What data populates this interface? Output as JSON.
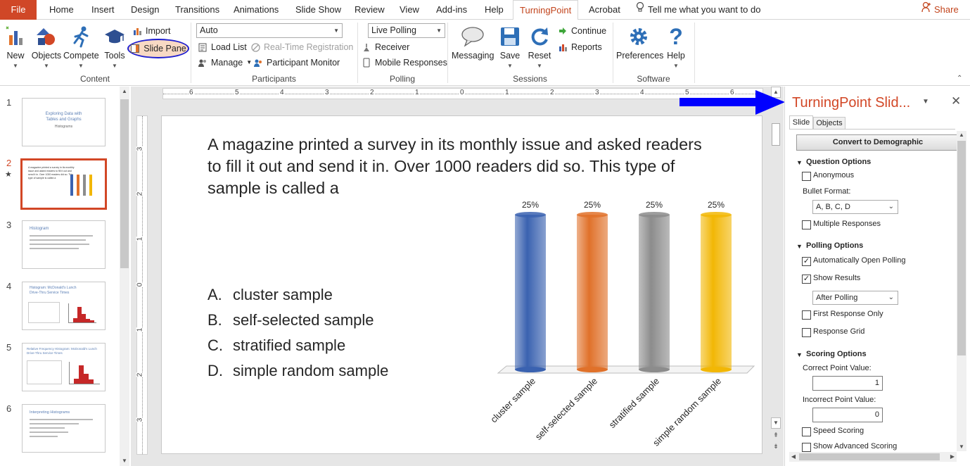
{
  "tabs": {
    "file": "File",
    "home": "Home",
    "insert": "Insert",
    "design": "Design",
    "transitions": "Transitions",
    "animations": "Animations",
    "slideshow": "Slide Show",
    "review": "Review",
    "view": "View",
    "addins": "Add-ins",
    "help": "Help",
    "turningpoint": "TurningPoint",
    "acrobat": "Acrobat",
    "tellme": "Tell me what you want to do",
    "share": "Share"
  },
  "ribbon": {
    "content": {
      "new": "New",
      "objects": "Objects",
      "compete": "Compete",
      "tools": "Tools",
      "import": "Import",
      "slide_pane": "Slide Pane",
      "label": "Content"
    },
    "participants": {
      "combo": "Auto",
      "load_list": "Load List",
      "realtime": "Real-Time Registration",
      "manage": "Manage",
      "monitor": "Participant Monitor",
      "label": "Participants"
    },
    "polling": {
      "combo": "Live Polling",
      "receiver": "Receiver",
      "mobile": "Mobile Responses",
      "label": "Polling"
    },
    "sessions": {
      "messaging": "Messaging",
      "save": "Save",
      "reset": "Reset",
      "continue": "Continue",
      "reports": "Reports",
      "label": "Sessions"
    },
    "software": {
      "preferences": "Preferences",
      "help": "Help",
      "label": "Software"
    }
  },
  "thumbnails": [
    {
      "num": "1",
      "title": "Exploring Data with Tables and Graphs",
      "sub": "Histograms"
    },
    {
      "num": "2",
      "title": "A magazine printed a survey in its monthly issue and asked readers to fill it out and send it in. Over 1000 readers did so. This type of sample is called a",
      "sub": ""
    },
    {
      "num": "3",
      "title": "Histogram",
      "sub": ""
    },
    {
      "num": "4",
      "title": "Histogram: McDonald's Lunch Drive-Thru Service Times",
      "sub": ""
    },
    {
      "num": "5",
      "title": "Relative Frequency Histogram: McDonald's Lunch Drive-Thru Service Times",
      "sub": ""
    },
    {
      "num": "6",
      "title": "Interpreting Histograms",
      "sub": ""
    }
  ],
  "ruler": {
    "h": [
      "6",
      "5",
      "4",
      "3",
      "2",
      "1",
      "0",
      "1",
      "2",
      "3",
      "4",
      "5",
      "6"
    ],
    "v": [
      "3",
      "2",
      "1",
      "0",
      "1",
      "2",
      "3"
    ]
  },
  "slide": {
    "question": "A magazine printed a survey in its monthly issue and asked readers to fill it out and send it in. Over 1000 readers did so. This type of sample is called a",
    "answers": [
      {
        "letter": "A.",
        "text": "cluster sample"
      },
      {
        "letter": "B.",
        "text": "self-selected sample"
      },
      {
        "letter": "C.",
        "text": "stratified sample"
      },
      {
        "letter": "D.",
        "text": "simple random sample"
      }
    ]
  },
  "chart_data": {
    "type": "bar",
    "categories": [
      "cluster sample",
      "self-selected sample",
      "stratified sample",
      "simple random sample"
    ],
    "values": [
      25,
      25,
      25,
      25
    ],
    "data_labels": [
      "25%",
      "25%",
      "25%",
      "25%"
    ],
    "colors": [
      "#3a62b0",
      "#e0712a",
      "#8c8c8c",
      "#f2b705"
    ],
    "ylim": [
      0,
      25
    ]
  },
  "pane": {
    "title": "TurningPoint Slid...",
    "tab_slide": "Slide",
    "tab_objects": "Objects",
    "convert": "Convert to Demographic",
    "question_options": "Question Options",
    "anonymous": "Anonymous",
    "bullet_format_label": "Bullet Format:",
    "bullet_format": "A, B, C, D",
    "multiple_responses": "Multiple Responses",
    "polling_options": "Polling Options",
    "auto_open": "Automatically Open Polling",
    "show_results": "Show Results",
    "show_results_when": "After Polling",
    "first_response": "First Response Only",
    "response_grid": "Response Grid",
    "scoring_options": "Scoring Options",
    "correct_label": "Correct Point Value:",
    "correct_value": "1",
    "incorrect_label": "Incorrect Point Value:",
    "incorrect_value": "0",
    "speed_scoring": "Speed Scoring",
    "advanced_scoring": "Show Advanced Scoring"
  },
  "colors": {
    "accent": "#d24726",
    "annotation_arrow": "#0000ff",
    "annotation_circle": "#1f1fd0"
  }
}
